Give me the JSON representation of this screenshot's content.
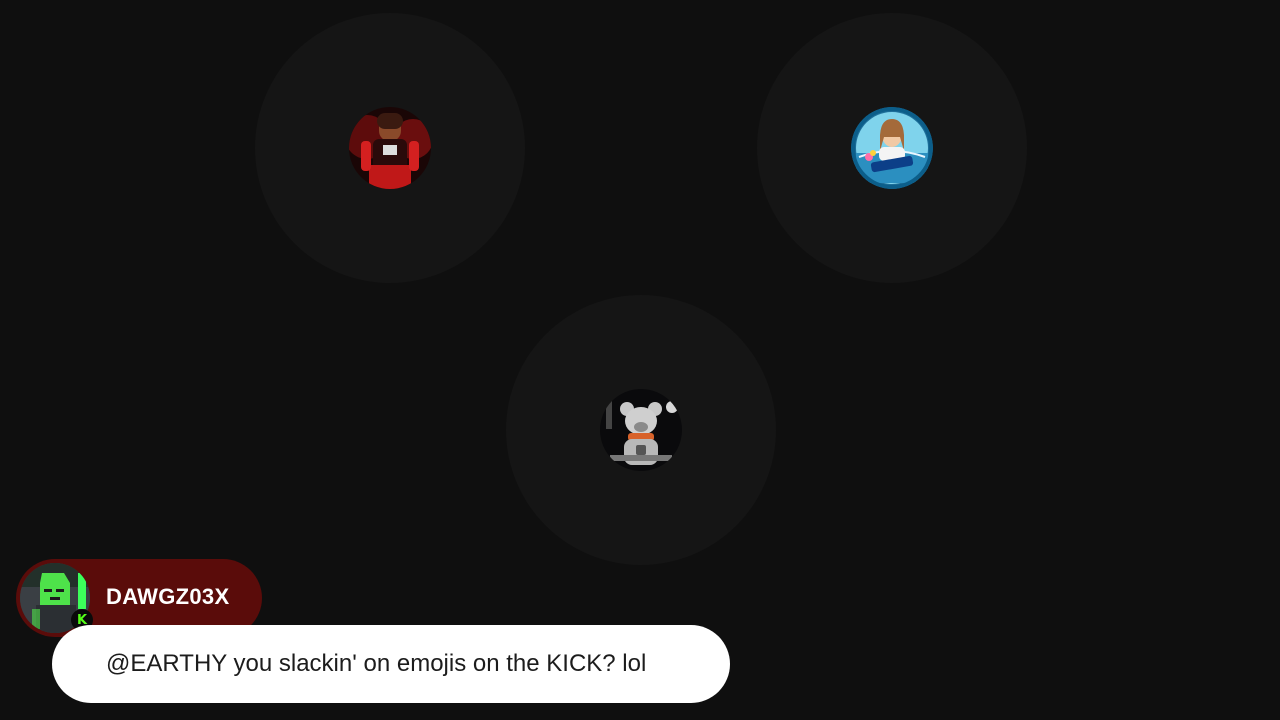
{
  "speakers": [
    {
      "avatar_icon": "participant-avatar-red-character-icon",
      "ring_color": "#151515"
    },
    {
      "avatar_icon": "participant-avatar-nonsense-badge-icon",
      "ring_color": "#151515"
    },
    {
      "avatar_icon": "participant-avatar-space-bear-icon",
      "ring_color": "#151515"
    }
  ],
  "chat": {
    "username": "DAWGZ03X",
    "message": "@EARTHY you slackin' on emojis on the KICK? lol",
    "platform_badge": "K",
    "platform_icon": "kick-logo-icon",
    "name_pill_color": "#5a0c0a",
    "message_bg_color": "#ffffff",
    "badge_color": "#53fc18"
  },
  "colors": {
    "background": "#0f0f0f",
    "halo": "#151515"
  }
}
